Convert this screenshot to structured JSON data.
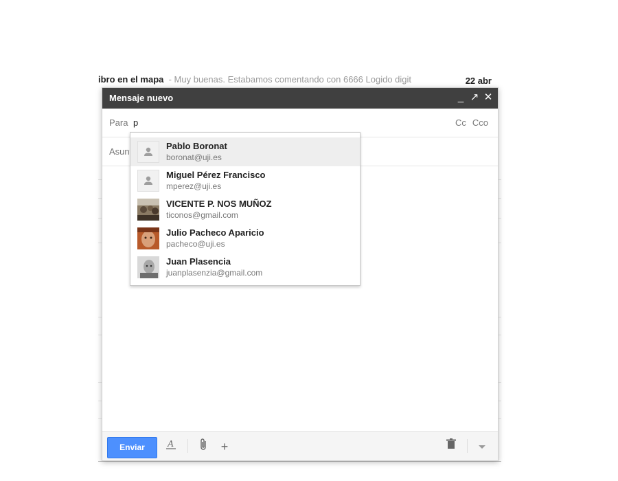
{
  "background": {
    "row_subject_prefix": "ibro en el mapa",
    "row_snippet": "Muy buenas. Estabamos comentando con 6666 Logido digit",
    "row_date": "22 abr"
  },
  "compose": {
    "title": "Mensaje nuevo",
    "controls": {
      "minimize": "_",
      "popout": "↗",
      "close": "✕"
    },
    "to_label": "Para",
    "to_value": "p",
    "cc_label": "Cc",
    "bcc_label": "Cco",
    "subject_label": "Asunto",
    "send_label": "Enviar",
    "accent_color": "#4d90fe"
  },
  "autocomplete": {
    "items": [
      {
        "name": "Pablo Boronat",
        "email": "boronat@uji.es",
        "avatar": "person-placeholder-icon",
        "selected": true
      },
      {
        "name": "Miguel Pérez Francisco",
        "email": "mperez@uji.es",
        "avatar": "person-placeholder-icon",
        "selected": false
      },
      {
        "name": "VICENTE P. NOS MUÑOZ",
        "email": "ticonos@gmail.com",
        "avatar": "photo",
        "selected": false
      },
      {
        "name": "Julio Pacheco Aparicio",
        "email": "pacheco@uji.es",
        "avatar": "photo",
        "selected": false
      },
      {
        "name": "Juan Plasencia",
        "email": "juanplasenzia@gmail.com",
        "avatar": "photo",
        "selected": false
      }
    ]
  },
  "toolbar_icons": [
    "text-format-icon",
    "attach-icon",
    "plus-icon",
    "trash-icon",
    "more-options-icon"
  ]
}
